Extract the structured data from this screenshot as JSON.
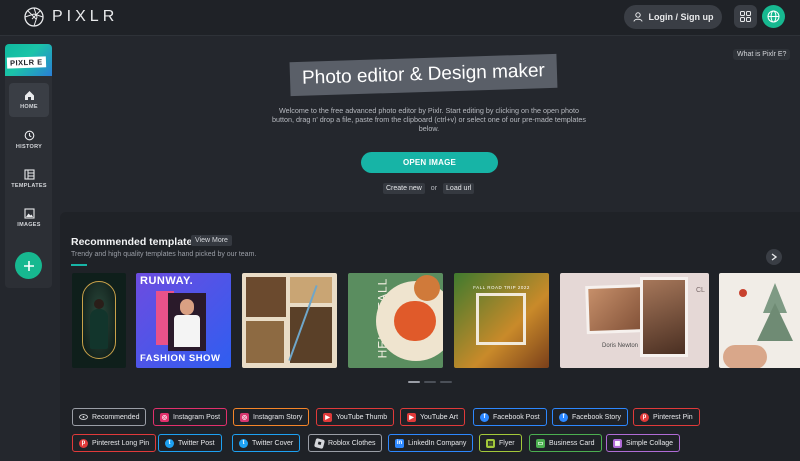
{
  "app": {
    "logo_text": "PIXLR",
    "brand_badge": "PIXLR E"
  },
  "header": {
    "login_label": "Login / Sign up"
  },
  "sidebar": {
    "items": [
      {
        "label": "HOME",
        "icon": "home-icon"
      },
      {
        "label": "HISTORY",
        "icon": "history-icon"
      },
      {
        "label": "TEMPLATES",
        "icon": "templates-icon"
      },
      {
        "label": "IMAGES",
        "icon": "images-icon"
      }
    ]
  },
  "hero": {
    "what_is": "What is Pixlr E?",
    "title": "Photo editor & Design maker",
    "description": "Welcome to the free advanced photo editor by Pixlr. Start editing by clicking on the open photo button, drag n' drop a file, paste from the clipboard (ctrl+v) or select one of our pre-made templates below.",
    "open_button": "OPEN IMAGE",
    "create_new": "Create new",
    "or": "or",
    "load_url": "Load url"
  },
  "recommended": {
    "title": "Recommended templates",
    "view_more": "View More",
    "subtitle": "Trendy and high quality templates hand picked by our team.",
    "thumbs": [
      {
        "alt": "woman in green dress"
      },
      {
        "alt": "fashion show",
        "line1": "RUNWAY.",
        "line2": "FASHION SHOW"
      },
      {
        "alt": "autumn collage"
      },
      {
        "alt": "hello fall",
        "text": "HELLO FALL"
      },
      {
        "alt": "fall trip aerial",
        "text": "FALL ROAD TRIP 2022"
      },
      {
        "alt": "photo collage",
        "name": "Doris Newton",
        "corner": "CL"
      },
      {
        "alt": "christmas"
      }
    ]
  },
  "categories": [
    {
      "label": "Recommended",
      "color": "#9a9ea6",
      "icon": "eye-icon"
    },
    {
      "label": "Instagram Post",
      "color": "#e1306c",
      "icon": "instagram-icon"
    },
    {
      "label": "Instagram Story",
      "color": "#f58529",
      "icon": "instagram-icon"
    },
    {
      "label": "YouTube Thumb",
      "color": "#e03a3a",
      "icon": "youtube-icon"
    },
    {
      "label": "YouTube Art",
      "color": "#e03a3a",
      "icon": "youtube-icon"
    },
    {
      "label": "Facebook Post",
      "color": "#2d88ff",
      "icon": "facebook-icon"
    },
    {
      "label": "Facebook Story",
      "color": "#2d88ff",
      "icon": "facebook-icon"
    },
    {
      "label": "Pinterest Pin",
      "color": "#e03a3a",
      "icon": "pinterest-icon"
    },
    {
      "label": "Pinterest Long Pin",
      "color": "#e03a3a",
      "icon": "pinterest-icon"
    },
    {
      "label": "Twitter Post",
      "color": "#1da1f2",
      "icon": "twitter-icon"
    },
    {
      "label": "Twitter Cover",
      "color": "#1da1f2",
      "icon": "twitter-icon"
    },
    {
      "label": "Roblox Clothes",
      "color": "#9a9ea6",
      "icon": "roblox-icon"
    },
    {
      "label": "LinkedIn Company",
      "color": "#2d88ff",
      "icon": "linkedin-icon"
    },
    {
      "label": "Flyer",
      "color": "#a3c93a",
      "icon": "flyer-icon"
    },
    {
      "label": "Business Card",
      "color": "#4caf50",
      "icon": "business-card-icon"
    },
    {
      "label": "Simple Collage",
      "color": "#b06bd6",
      "icon": "collage-icon"
    }
  ],
  "colors": {
    "accent": "#17b4a6",
    "background": "#24272d",
    "panel": "#1f2227"
  }
}
